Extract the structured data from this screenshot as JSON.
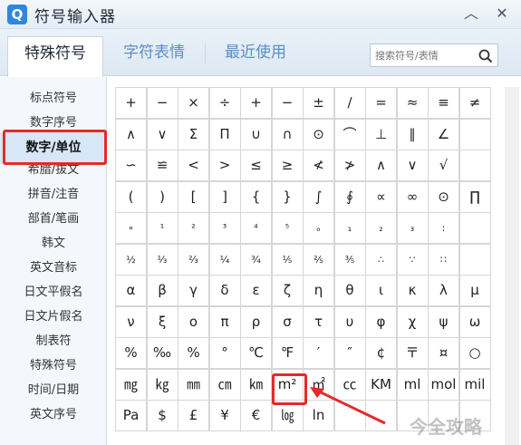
{
  "window": {
    "title": "符号输入器",
    "app_icon": "Q",
    "minimize_glyph": "︿",
    "close_glyph": "✕"
  },
  "tabs": [
    {
      "label": "特殊符号",
      "active": true
    },
    {
      "label": "字符表情",
      "active": false
    },
    {
      "label": "最近使用",
      "active": false
    }
  ],
  "search": {
    "placeholder": "搜索符号/表情",
    "value": ""
  },
  "sidebar": {
    "items": [
      {
        "label": "标点符号"
      },
      {
        "label": "数字序号"
      },
      {
        "label": "数字/单位",
        "active": true
      },
      {
        "label": "希腊/拔文"
      },
      {
        "label": "拼音/注音"
      },
      {
        "label": "部首/笔画"
      },
      {
        "label": "韩文"
      },
      {
        "label": "英文音标"
      },
      {
        "label": "日文平假名"
      },
      {
        "label": "日文片假名"
      },
      {
        "label": "制表符"
      },
      {
        "label": "特殊符号"
      },
      {
        "label": "时间/日期"
      },
      {
        "label": "英文序号"
      }
    ]
  },
  "grid": {
    "rows": [
      [
        "+",
        "−",
        "×",
        "÷",
        "+",
        "−",
        "±",
        "∕",
        "=",
        "≈",
        "≡",
        "≠"
      ],
      [
        "∧",
        "∨",
        "Σ",
        "Π",
        "∪",
        "∩",
        "⊙",
        "⌒",
        "⊥",
        "∥",
        "∠",
        ""
      ],
      [
        "∽",
        "≌",
        "<",
        ">",
        "≤",
        "≥",
        "≮",
        "≯",
        "∧",
        "∨",
        "√",
        ""
      ],
      [
        "(",
        ")",
        "[",
        "]",
        "{",
        "}",
        "∫",
        "∮",
        "∝",
        "∞",
        "⊙",
        "∏"
      ],
      [
        "∘",
        "¹",
        "²",
        "³",
        "⁴",
        "⁵",
        "ₒ",
        "₁",
        "₂",
        "₃",
        ":",
        ""
      ],
      [
        "½",
        "⅓",
        "⅔",
        "¼",
        "¾",
        "⅕",
        "⅖",
        "⅗",
        "∴",
        "∵",
        "∷",
        ""
      ],
      [
        "α",
        "β",
        "γ",
        "δ",
        "ε",
        "ζ",
        "η",
        "θ",
        "ι",
        "κ",
        "λ",
        "μ"
      ],
      [
        "ν",
        "ξ",
        "ο",
        "π",
        "ρ",
        "σ",
        "τ",
        "υ",
        "φ",
        "χ",
        "ψ",
        "ω"
      ],
      [
        "%",
        "‰",
        "%",
        "°",
        "℃",
        "℉",
        "′",
        "″",
        "¢",
        "〒",
        "¤",
        "○"
      ],
      [
        "㎎",
        "㎏",
        "㎜",
        "㎝",
        "㎞",
        "m²",
        "㎡",
        "㏄",
        "KM",
        "ml",
        "mol",
        "mil"
      ],
      [
        "Pa",
        "$",
        "£",
        "¥",
        "€",
        "㏒",
        "ln",
        "",
        "",
        "",
        "",
        ""
      ]
    ]
  },
  "watermark": "今全攻略",
  "colors": {
    "accent": "#2f86e0",
    "highlight": "#e42a2a",
    "tab_text": "#5a8fc7"
  }
}
